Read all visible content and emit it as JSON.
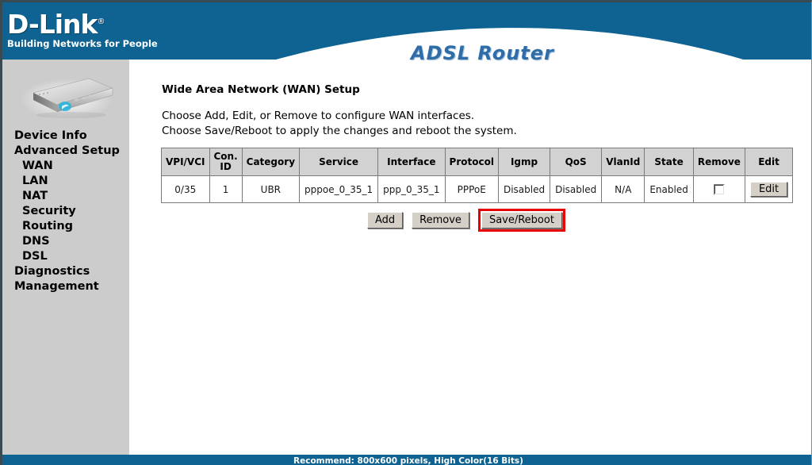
{
  "branding": {
    "logo_text": "D-Link",
    "logo_registered": "®",
    "tagline": "Building Networks for People",
    "app_title": "ADSL Router",
    "header_color": "#0f6392",
    "title_color": "#2e6da8"
  },
  "sidebar": {
    "device_image_alt": "router-device",
    "items": [
      {
        "label": "Device Info",
        "level": 0
      },
      {
        "label": "Advanced Setup",
        "level": 0
      },
      {
        "label": "WAN",
        "level": 1
      },
      {
        "label": "LAN",
        "level": 1
      },
      {
        "label": "NAT",
        "level": 1
      },
      {
        "label": "Security",
        "level": 1
      },
      {
        "label": "Routing",
        "level": 1
      },
      {
        "label": "DNS",
        "level": 1
      },
      {
        "label": "DSL",
        "level": 1
      },
      {
        "label": "Diagnostics",
        "level": 0
      },
      {
        "label": "Management",
        "level": 0
      }
    ]
  },
  "main": {
    "page_title": "Wide Area Network (WAN) Setup",
    "instruction_line_1": "Choose Add, Edit, or Remove to configure WAN interfaces.",
    "instruction_line_2": "Choose Save/Reboot to apply the changes and reboot the system.",
    "table": {
      "headers": [
        "VPI/VCI",
        "Con. ID",
        "Category",
        "Service",
        "Interface",
        "Protocol",
        "Igmp",
        "QoS",
        "VlanId",
        "State",
        "Remove",
        "Edit"
      ],
      "header_conid_line1": "Con.",
      "header_conid_line2": "ID",
      "rows": [
        {
          "vpi_vci": "0/35",
          "con_id": "1",
          "category": "UBR",
          "service": "pppoe_0_35_1",
          "interface": "ppp_0_35_1",
          "protocol": "PPPoE",
          "igmp": "Disabled",
          "qos": "Disabled",
          "vlanid": "N/A",
          "state": "Enabled",
          "remove_checked": false,
          "edit_label": "Edit"
        }
      ]
    },
    "buttons": {
      "add": "Add",
      "remove": "Remove",
      "save_reboot": "Save/Reboot"
    },
    "highlight": {
      "target": "save_reboot",
      "color": "#e60000"
    }
  },
  "footer": {
    "text": "Recommend: 800x600 pixels, High Color(16 Bits)"
  }
}
